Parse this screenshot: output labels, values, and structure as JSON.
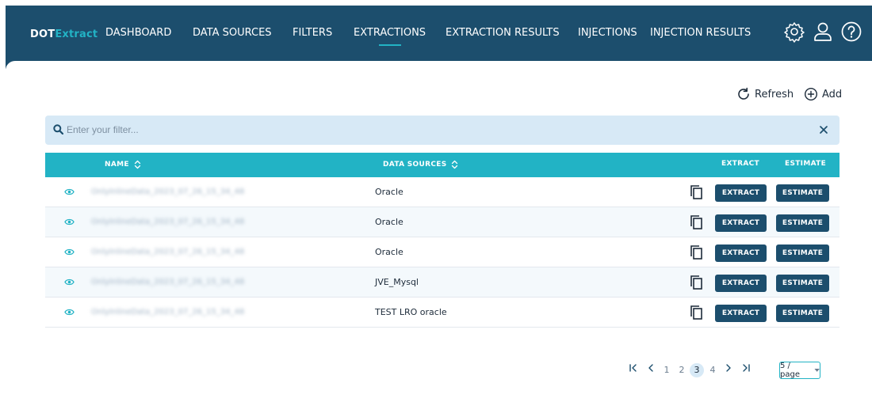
{
  "app": {
    "logo_dot": "DOT",
    "logo_extract": "Extract"
  },
  "nav": {
    "dashboard": "DASHBOARD",
    "data_sources": "DATA SOURCES",
    "filters": "FILTERS",
    "extractions": "EXTRACTIONS",
    "extraction_results": "EXTRACTION RESULTS",
    "injections": "INJECTIONS",
    "injection_results": "INJECTION RESULTS",
    "active": "EXTRACTIONS"
  },
  "toolbar": {
    "refresh_label": "Refresh",
    "add_label": "Add"
  },
  "filter": {
    "placeholder": "Enter your filter...",
    "value": ""
  },
  "table": {
    "headers": {
      "name": "NAME",
      "data_sources": "DATA SOURCES",
      "extract": "EXTRACT",
      "estimate": "ESTIMATE"
    },
    "rows": [
      {
        "name": "OnlyInlineData_2023_07_26_15_34_48",
        "data_source": "Oracle",
        "extract_label": "EXTRACT",
        "estimate_label": "ESTIMATE"
      },
      {
        "name": "OnlyInlineData_2023_07_26_15_34_48",
        "data_source": "Oracle",
        "extract_label": "EXTRACT",
        "estimate_label": "ESTIMATE"
      },
      {
        "name": "OnlyInlineData_2023_07_26_15_34_48",
        "data_source": "Oracle",
        "extract_label": "EXTRACT",
        "estimate_label": "ESTIMATE"
      },
      {
        "name": "OnlyInlineData_2023_07_26_15_34_48",
        "data_source": "JVE_Mysql",
        "extract_label": "EXTRACT",
        "estimate_label": "ESTIMATE"
      },
      {
        "name": "OnlyInlineData_2023_07_26_15_34_48",
        "data_source": "TEST LRO oracle",
        "extract_label": "EXTRACT",
        "estimate_label": "ESTIMATE"
      }
    ]
  },
  "pagination": {
    "pages": [
      "1",
      "2",
      "3",
      "4"
    ],
    "current": "3",
    "page_size": "5 / page"
  },
  "icons": {
    "settings": "gear-icon",
    "user": "user-icon",
    "help": "help-icon",
    "refresh": "refresh-icon",
    "add": "plus-circle-icon",
    "search": "search-icon",
    "clear": "close-icon",
    "sort": "sort-icon",
    "view": "eye-icon",
    "copy": "copy-icon"
  },
  "colors": {
    "header_bg": "#1c4e6d",
    "accent": "#22b3c5",
    "filter_bg": "#d7e9f6",
    "button_bg": "#1c4e6d"
  }
}
